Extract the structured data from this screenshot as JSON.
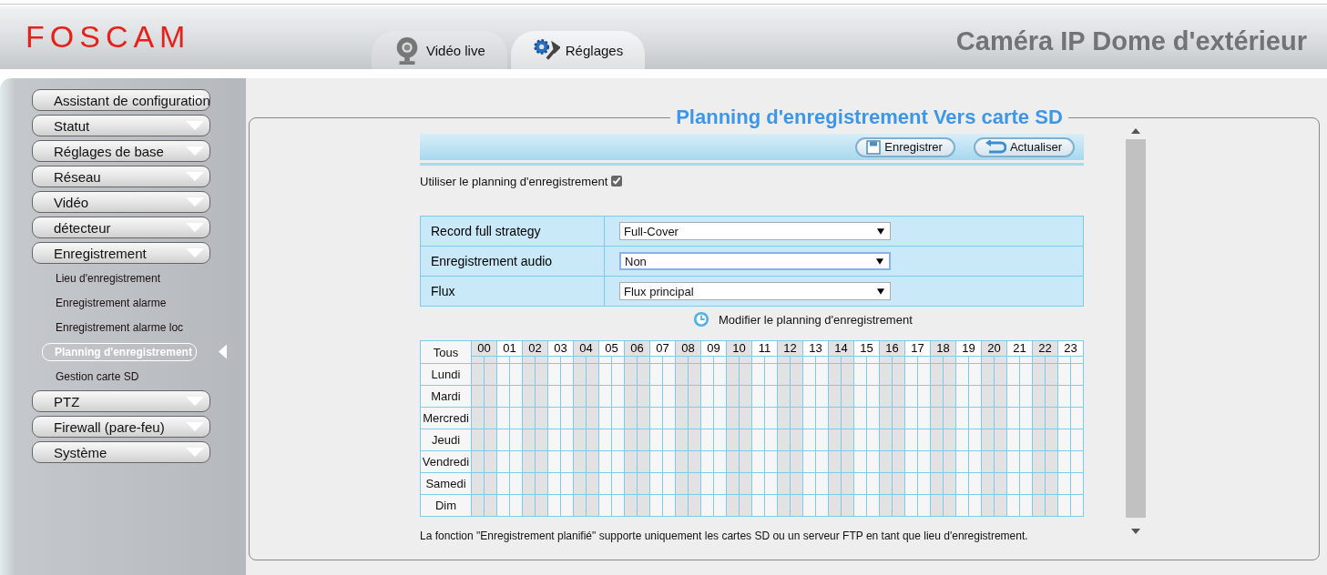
{
  "header": {
    "logo": "FOSCAM",
    "title": "Caméra IP Dome d'extérieur"
  },
  "tabs": [
    {
      "label": "Vidéo live",
      "selected": false
    },
    {
      "label": "Réglages",
      "selected": true
    }
  ],
  "sidebar": {
    "items": [
      {
        "label": "Assistant de configuration"
      },
      {
        "label": "Statut"
      },
      {
        "label": "Réglages de base"
      },
      {
        "label": "Réseau"
      },
      {
        "label": "Vidéo"
      },
      {
        "label": "détecteur"
      },
      {
        "label": "Enregistrement",
        "children": [
          {
            "label": "Lieu d'enregistrement",
            "selected": false
          },
          {
            "label": "Enregistrement alarme",
            "selected": false
          },
          {
            "label": "Enregistrement alarme loc",
            "selected": false
          },
          {
            "label": "Planning d'enregistrement",
            "selected": true
          },
          {
            "label": "Gestion carte SD",
            "selected": false
          }
        ]
      },
      {
        "label": "PTZ"
      },
      {
        "label": "Firewall (pare-feu)"
      },
      {
        "label": "Système"
      }
    ]
  },
  "panel": {
    "title": "Planning d'enregistrement Vers carte SD",
    "toolbar": [
      {
        "label": "Enregistrer"
      },
      {
        "label": "Actualiser"
      }
    ],
    "enable": {
      "label": "Utiliser le planning d'enregistrement",
      "checked": true
    },
    "settings": [
      {
        "label": "Record full strategy",
        "value": "Full-Cover",
        "focused": false
      },
      {
        "label": "Enregistrement audio",
        "value": "Non",
        "focused": true
      },
      {
        "label": "Flux",
        "value": "Flux principal",
        "focused": false
      }
    ],
    "edit_link": "Modifier le planning d'enregistrement",
    "schedule": {
      "all_label": "Tous",
      "hours": [
        "00",
        "01",
        "02",
        "03",
        "04",
        "05",
        "06",
        "07",
        "08",
        "09",
        "10",
        "11",
        "12",
        "13",
        "14",
        "15",
        "16",
        "17",
        "18",
        "19",
        "20",
        "21",
        "22",
        "23"
      ],
      "days": [
        "Lundi",
        "Mardi",
        "Mercredi",
        "Jeudi",
        "Vendredi",
        "Samedi",
        "Dim"
      ]
    },
    "note": "La fonction \"Enregistrement planifié\" supporte uniquement les cartes SD ou un serveur FTP en tant que lieu d'enregistrement."
  }
}
